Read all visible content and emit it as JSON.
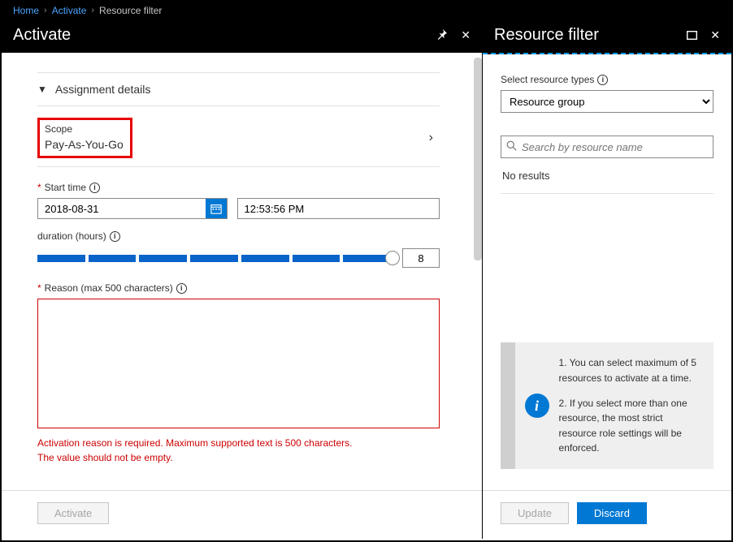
{
  "breadcrumb": {
    "home": "Home",
    "activate": "Activate",
    "filter": "Resource filter"
  },
  "left": {
    "title": "Activate",
    "section_label": "Assignment details",
    "scope_label": "Scope",
    "scope_value": "Pay-As-You-Go",
    "start_time_label": "Start time",
    "date_value": "2018-08-31",
    "time_value": "12:53:56 PM",
    "duration_label": "duration (hours)",
    "duration_value": "8",
    "reason_label": "Reason (max 500 characters)",
    "reason_value": "",
    "error_line1": "Activation reason is required. Maximum supported text is 500 characters.",
    "error_line2": "The value should not be empty.",
    "activate_btn": "Activate"
  },
  "right": {
    "title": "Resource filter",
    "select_label": "Select resource types",
    "select_value": "Resource group",
    "search_placeholder": "Search by resource name",
    "no_results": "No results",
    "help1": "1. You can select maximum of 5 resources to activate at a time.",
    "help2": "2. If you select more than one resource, the most strict resource role settings will be enforced.",
    "update_btn": "Update",
    "discard_btn": "Discard"
  }
}
